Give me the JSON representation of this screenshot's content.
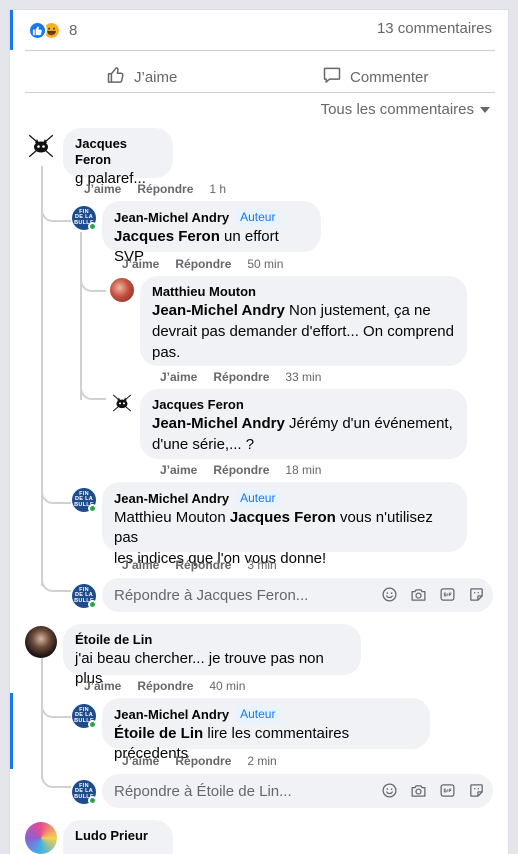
{
  "colors": {
    "accent": "#1877f2",
    "online": "#31a24c",
    "bubble": "#f0f2f5",
    "muted": "#65676b"
  },
  "post": {
    "reaction_count": "8",
    "comment_count": "13 commentaires",
    "like_label": "J’aime",
    "comment_label": "Commenter",
    "sort_label": "Tous les commentaires"
  },
  "comments": [
    {
      "author": "Jacques Feron",
      "text": "g palaref...",
      "like": "J’aime",
      "reply": "Répondre",
      "time": "1 h",
      "replies": [
        {
          "author": "Jean-Michel Andry",
          "badge": "Auteur",
          "tag": "Jacques Feron",
          "text": " un effort SVP",
          "like": "J’aime",
          "reply": "Répondre",
          "time": "50 min",
          "replies": [
            {
              "author": "Matthieu Mouton",
              "tag": "Jean-Michel Andry",
              "text1": " Non justement, ça ne",
              "text2": "devrait pas demander d'effort... On comprend",
              "text3": "pas.",
              "like": "J’aime",
              "reply": "Répondre",
              "time": "33 min"
            },
            {
              "author": "Jacques Feron",
              "tag": "Jean-Michel Andry",
              "text1": " Jérémy d'un événement,",
              "text2": "d'une série,... ?",
              "like": "J’aime",
              "reply": "Répondre",
              "time": "18 min"
            }
          ]
        },
        {
          "author": "Jean-Michel Andry",
          "badge": "Auteur",
          "pre": "Matthieu Mouton ",
          "tag": "Jacques Feron",
          "text1": " vous n'utilisez pas",
          "text2": "les indices que l'on vous donne!",
          "like": "J’aime",
          "reply": "Répondre",
          "time": "3 min"
        }
      ],
      "reply_placeholder": "Répondre à Jacques Feron..."
    },
    {
      "author": "Étoile de Lin",
      "text": "j'ai beau chercher... je trouve pas non plus",
      "like": "J’aime",
      "reply": "Répondre",
      "time": "40 min",
      "replies": [
        {
          "author": "Jean-Michel Andry",
          "badge": "Auteur",
          "tag": "Étoile de Lin",
          "text": " lire les commentaires précedents",
          "like": "J’aime",
          "reply": "Répondre",
          "time": "2 min"
        }
      ],
      "reply_placeholder": "Répondre à Étoile de Lin..."
    },
    {
      "author": "Ludo Prieur"
    }
  ],
  "avatar_text": {
    "fin_line1": "FIN",
    "fin_line2": "DE LA",
    "fin_line3": "BULLE"
  },
  "icons": [
    "like-reaction-icon",
    "haha-reaction-icon",
    "thumbs-up-icon",
    "comment-icon",
    "caret-down-icon",
    "emoji-icon",
    "camera-icon",
    "gif-icon",
    "sticker-icon"
  ]
}
